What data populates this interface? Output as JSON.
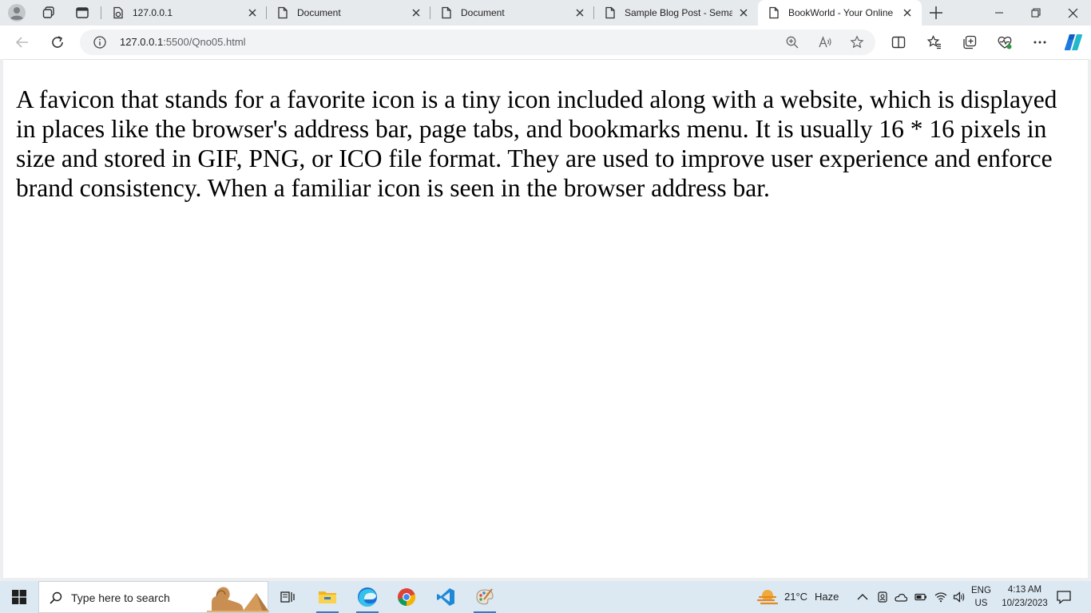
{
  "browser": {
    "tabs": [
      {
        "label": "127.0.0.1",
        "icon": "loading-page-icon",
        "active": false
      },
      {
        "label": "Document",
        "icon": "page-icon",
        "active": false
      },
      {
        "label": "Document",
        "icon": "page-icon",
        "active": false
      },
      {
        "label": "Sample Blog Post - Seman",
        "icon": "page-icon",
        "active": false
      },
      {
        "label": "BookWorld - Your Online E",
        "icon": "page-icon",
        "active": true
      }
    ],
    "address": {
      "host": "127.0.0.1",
      "path": ":5500/Qno05.html"
    }
  },
  "page": {
    "paragraph": "A favicon that stands for a favorite icon is a tiny icon included along with a website, which is displayed in places like the browser's address bar, page tabs, and bookmarks menu. It is usually 16 * 16 pixels in size and stored in GIF, PNG, or ICO file format. They are used to improve user experience and enforce brand consistency. When a familiar icon is seen in the browser address bar."
  },
  "taskbar": {
    "search_placeholder": "Type here to search",
    "weather": {
      "temp": "21°C",
      "condition": "Haze"
    },
    "language": {
      "lang": "ENG",
      "region": "US"
    },
    "clock": {
      "time": "4:13 AM",
      "date": "10/23/2023"
    }
  },
  "colors": {
    "tab_strip": "#e7eaed",
    "taskbar": "#dce9f3",
    "accent": "#3478c6"
  }
}
